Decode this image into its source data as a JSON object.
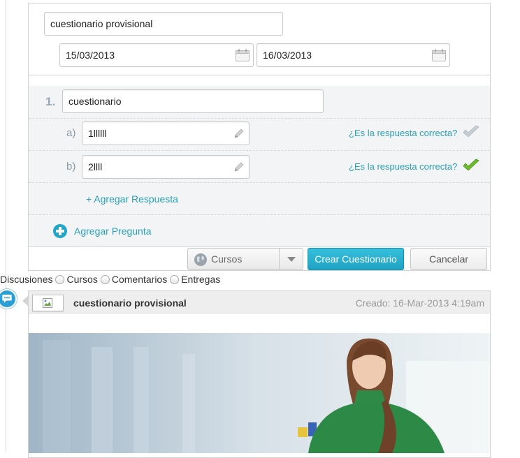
{
  "form": {
    "title_value": "cuestionario provisional",
    "start_date": "15/03/2013",
    "end_date": "16/03/2013"
  },
  "question": {
    "number": "1.",
    "text": "cuestionario",
    "answers": [
      {
        "letter": "a)",
        "value": "1llllll",
        "correct_label": "¿Es la respuesta correcta?",
        "is_correct": false
      },
      {
        "letter": "b)",
        "value": "2llll",
        "correct_label": "¿Es la respuesta correcta?",
        "is_correct": true
      }
    ],
    "add_answer": "+ Agregar Respuesta"
  },
  "add_question": "Agregar Pregunta",
  "toolbar": {
    "scope_select": "Cursos",
    "create_button": "Crear Cuestionario",
    "cancel_button": "Cancelar"
  },
  "filters": {
    "label": "Discusiones",
    "options": [
      "Cursos",
      "Comentarios",
      "Entregas"
    ]
  },
  "post": {
    "title": "cuestionario provisional",
    "created": "Creado: 16-Mar-2013 4:19am"
  },
  "colors": {
    "accent": "#2a9fb5",
    "button_primary": "#2ab0cc",
    "check_green": "#5cab2a"
  },
  "icons": [
    "calendar-icon",
    "pencil-icon",
    "check-icon",
    "plus-circle-icon",
    "globe-icon",
    "caret-down-icon",
    "chat-bubble-icon",
    "broken-image-icon"
  ]
}
